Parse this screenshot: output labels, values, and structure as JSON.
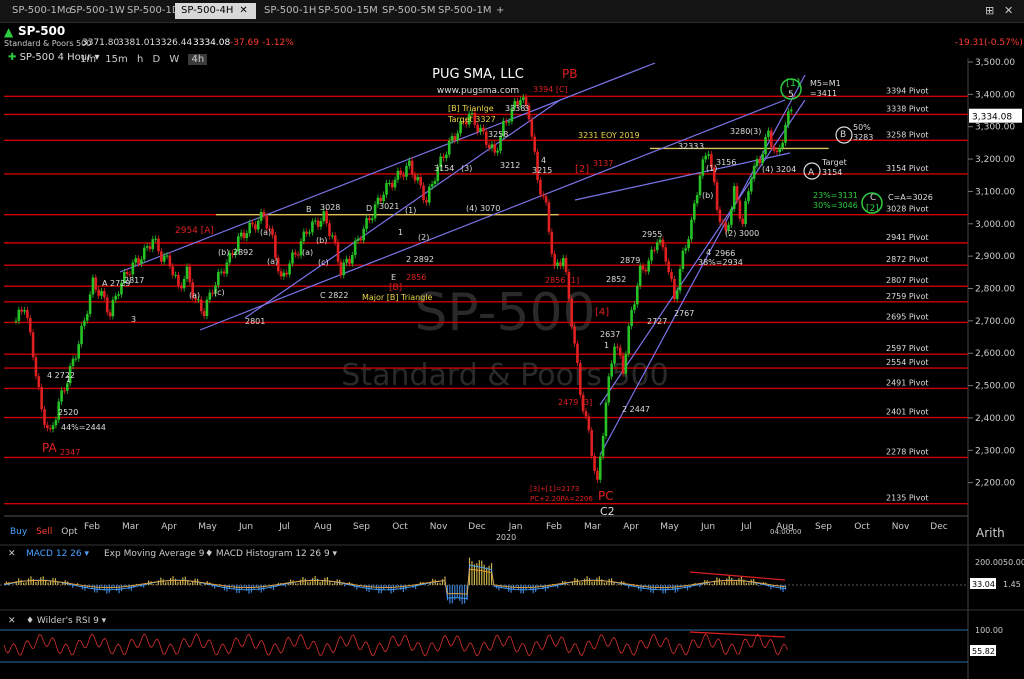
{
  "tabs": [
    {
      "label": "SP-500-1Mo",
      "active": false
    },
    {
      "label": "SP-500-1W",
      "active": false
    },
    {
      "label": "SP-500-1D",
      "active": false
    },
    {
      "label": "SP-500-4H",
      "active": true
    },
    {
      "label": "SP-500-1H",
      "active": false
    },
    {
      "label": "SP-500-15M",
      "active": false
    },
    {
      "label": "SP-500-5M",
      "active": false
    },
    {
      "label": "SP-500-1M",
      "active": false
    }
  ],
  "tab_plus": "+",
  "header": {
    "symbol": "SP-500",
    "description": "Standard & Poors 500",
    "open": "3371.80",
    "high": "3381.01",
    "low": "3326.44",
    "close": "3334.08",
    "change": "-37.69",
    "change_pct": "-1.12%",
    "right_change": "-19.31(-0.57%)"
  },
  "toolbar": {
    "panel_label": "SP-500 4 Hour",
    "timeframes": [
      "1m",
      "15m",
      "h",
      "D",
      "W",
      "4h"
    ]
  },
  "panels": {
    "macd_label": "MACD 12 26",
    "ema_label": "Exp Moving Average 9",
    "hist_label": "MACD Histogram 12 26 9",
    "rsi_label": "Wilder's RSI 9",
    "macd_axis": [
      "200.00",
      "50.00",
      "33.04",
      "1.45"
    ],
    "rsi_axis": [
      "100.00",
      "55.82"
    ]
  },
  "bottom_left": {
    "buy": "Buy",
    "sell": "Sell",
    "opt": "Opt"
  },
  "arith": "Arith",
  "time_box": "04:00:00",
  "colors": {
    "pivot": "#cc0000",
    "channel": "#7a74e8",
    "yellow": "#d8c25a",
    "up": "#26c226",
    "down": "#e02020",
    "bg": "#000000"
  },
  "chart_data": {
    "type": "candlestick",
    "title": "PUG SMA, LLC",
    "subtitle": "www.pugsma.com",
    "watermark": [
      "SP-500",
      "Standard & Poors 500"
    ],
    "ylim": [
      2100,
      3500
    ],
    "y_ticks": [
      2200,
      2300,
      2400,
      2500,
      2600,
      2700,
      2800,
      2900,
      3000,
      3100,
      3200,
      3300,
      3400,
      3500
    ],
    "y_tick_labels": [
      "2,200.00",
      "2,300.00",
      "2,400.00",
      "2,500.00",
      "2,600.00",
      "2,700.00",
      "2,800.00",
      "2,900.00",
      "3,000.00",
      "3,100.00",
      "3,200.00",
      "3,300.00",
      "3,400.00",
      "3,500.00"
    ],
    "last_price_label": "3,334.08",
    "x_labels": [
      "Feb",
      "Mar",
      "Apr",
      "May",
      "Jun",
      "Jul",
      "Aug",
      "Sep",
      "Oct",
      "Nov",
      "Dec",
      "Jan",
      "Feb",
      "Mar",
      "Apr",
      "May",
      "Jun",
      "Jul",
      "Aug",
      "Sep",
      "Oct",
      "Nov",
      "Dec"
    ],
    "x_year_label": "2020",
    "pivots": [
      {
        "label": "3394 Pivot",
        "value": 3394
      },
      {
        "label": "3338 Pivot",
        "value": 3338
      },
      {
        "label": "3258 Pivot",
        "value": 3258
      },
      {
        "label": "3154 Pivot",
        "value": 3154
      },
      {
        "label": "3028 Pivot",
        "value": 3028
      },
      {
        "label": "2941 Pivot",
        "value": 2941
      },
      {
        "label": "2872 Pivot",
        "value": 2872
      },
      {
        "label": "2807 Pivot",
        "value": 2807
      },
      {
        "label": "2759 Pivot",
        "value": 2759
      },
      {
        "label": "2695 Pivot",
        "value": 2695
      },
      {
        "label": "2597 Pivot",
        "value": 2597
      },
      {
        "label": "2554 Pivot",
        "value": 2554
      },
      {
        "label": "2491 Pivot",
        "value": 2491
      },
      {
        "label": "2401 Pivot",
        "value": 2401
      },
      {
        "label": "2278 Pivot",
        "value": 2278
      },
      {
        "label": "2135 Pivot",
        "value": 2135
      }
    ],
    "yellow_lines": [
      {
        "x": [
          0.22,
          0.7
        ],
        "value": 3028
      },
      {
        "x": [
          0.67,
          0.98
        ],
        "value": 3233
      }
    ],
    "price_path": [
      [
        0,
        2700
      ],
      [
        1,
        2750
      ],
      [
        2,
        2600
      ],
      [
        3,
        2420
      ],
      [
        4,
        2347
      ],
      [
        5,
        2444
      ],
      [
        6,
        2520
      ],
      [
        7,
        2600
      ],
      [
        8,
        2700
      ],
      [
        9,
        2817
      ],
      [
        10,
        2780
      ],
      [
        11,
        2722
      ],
      [
        12,
        2800
      ],
      [
        13,
        2850
      ],
      [
        14,
        2880
      ],
      [
        15,
        2910
      ],
      [
        16,
        2954
      ],
      [
        17,
        2900
      ],
      [
        18,
        2880
      ],
      [
        19,
        2801
      ],
      [
        20,
        2850
      ],
      [
        21,
        2760
      ],
      [
        22,
        2729
      ],
      [
        23,
        2800
      ],
      [
        24,
        2850
      ],
      [
        25,
        2892
      ],
      [
        26,
        2950
      ],
      [
        27,
        2980
      ],
      [
        28,
        3000
      ],
      [
        29,
        3028
      ],
      [
        30,
        2950
      ],
      [
        31,
        2822
      ],
      [
        32,
        2880
      ],
      [
        33,
        2920
      ],
      [
        34,
        2980
      ],
      [
        35,
        3000
      ],
      [
        36,
        3021
      ],
      [
        37,
        2960
      ],
      [
        38,
        2856
      ],
      [
        39,
        2892
      ],
      [
        40,
        2950
      ],
      [
        41,
        3000
      ],
      [
        42,
        3050
      ],
      [
        43,
        3100
      ],
      [
        44,
        3130
      ],
      [
        45,
        3154
      ],
      [
        46,
        3180
      ],
      [
        47,
        3130
      ],
      [
        48,
        3070
      ],
      [
        49,
        3150
      ],
      [
        50,
        3212
      ],
      [
        51,
        3260
      ],
      [
        52,
        3300
      ],
      [
        53,
        3338
      ],
      [
        54,
        3300
      ],
      [
        55,
        3258
      ],
      [
        56,
        3215
      ],
      [
        57,
        3300
      ],
      [
        58,
        3350
      ],
      [
        59,
        3394
      ],
      [
        60,
        3340
      ],
      [
        61,
        3137
      ],
      [
        62,
        3050
      ],
      [
        63,
        2856
      ],
      [
        64,
        2900
      ],
      [
        65,
        2700
      ],
      [
        66,
        2479
      ],
      [
        67,
        2350
      ],
      [
        68,
        2192
      ],
      [
        69,
        2447
      ],
      [
        70,
        2637
      ],
      [
        71,
        2550
      ],
      [
        72,
        2727
      ],
      [
        73,
        2852
      ],
      [
        74,
        2879
      ],
      [
        75,
        2955
      ],
      [
        76,
        2900
      ],
      [
        77,
        2767
      ],
      [
        78,
        2900
      ],
      [
        79,
        3000
      ],
      [
        80,
        3156
      ],
      [
        81,
        3233
      ],
      [
        82,
        3050
      ],
      [
        83,
        2966
      ],
      [
        84,
        3100
      ],
      [
        85,
        3000
      ],
      [
        86,
        3156
      ],
      [
        87,
        3200
      ],
      [
        88,
        3280
      ],
      [
        89,
        3204
      ],
      [
        90,
        3300
      ],
      [
        91,
        3394
      ]
    ],
    "annotations": [
      {
        "text": "3394 [C]",
        "value": 3394
      },
      {
        "text": "PB",
        "value": 3440
      },
      {
        "text": "[B] Trianlge",
        "value": 3365
      },
      {
        "text": "Target 3327",
        "value": 3327
      },
      {
        "text": "3231 EOY 2019",
        "value": 3231
      },
      {
        "text": "Major [B] Triangle",
        "value": 2770
      },
      {
        "text": "PA",
        "value": 2350
      },
      {
        "text": "2347",
        "value": 2347
      },
      {
        "text": "44%=2444",
        "value": 2440
      },
      {
        "text": "PC",
        "value": 2195
      },
      {
        "text": "C2",
        "value": 2160
      },
      {
        "text": "[3]+[1]=2173",
        "value": 2173
      },
      {
        "text": "PC+2.20PA=2206",
        "value": 2206
      },
      {
        "text": "[1]",
        "value": 3445
      },
      {
        "text": "5",
        "value": 3412
      },
      {
        "text": "M5=M1",
        "value": 3445
      },
      {
        "text": "=3411",
        "value": 3411
      },
      {
        "text": "50%",
        "value": 3300
      },
      {
        "text": "3283",
        "value": 3283
      },
      {
        "text": "B",
        "value": 3290
      },
      {
        "text": "A",
        "value": 3165
      },
      {
        "text": "Target",
        "value": 3175
      },
      {
        "text": "3154",
        "value": 3150
      },
      {
        "text": "23%=3131",
        "value": 3131
      },
      {
        "text": "30%=3046",
        "value": 3046
      },
      {
        "text": "C",
        "value": 3120
      },
      {
        "text": "[2]",
        "value": 3040
      },
      {
        "text": "C=A=3026",
        "value": 3026
      },
      {
        "text": "38%=2934",
        "value": 2934
      },
      {
        "text": "2966",
        "value": 2966
      },
      {
        "text": "(2) 3000",
        "value": 3000
      },
      {
        "text": "(4) 3204",
        "value": 3204
      },
      {
        "text": "3280",
        "value": 3290
      },
      {
        "text": "(3)",
        "value": 3290
      },
      {
        "text": "3156",
        "value": 3190
      },
      {
        "text": "3233",
        "value": 3250
      },
      {
        "text": "3",
        "value": 3250
      },
      {
        "text": "(1)",
        "value": 3180
      },
      {
        "text": "(b)",
        "value": 3090
      },
      {
        "text": "4",
        "value": 2950
      },
      {
        "text": "2955",
        "value": 2980
      },
      {
        "text": "2879",
        "value": 2900
      },
      {
        "text": "2852",
        "value": 2840
      },
      {
        "text": "2727",
        "value": 2720
      },
      {
        "text": "2767",
        "value": 2740
      },
      {
        "text": "2637",
        "value": 2640
      },
      {
        "text": "1",
        "value": 2600
      },
      {
        "text": "2 2447",
        "value": 2420
      },
      {
        "text": "[4]",
        "value": 2740
      },
      {
        "text": "2479 [3]",
        "value": 2480
      },
      {
        "text": "2856 [1]",
        "value": 2860
      },
      {
        "text": "[2]",
        "value": 3140
      },
      {
        "text": "3137",
        "value": 3200
      },
      {
        "text": "3215",
        "value": 3190
      },
      {
        "text": "4",
        "value": 3210
      },
      {
        "text": "3212",
        "value": 3210
      },
      {
        "text": "3258",
        "value": 3270
      },
      {
        "text": "3338",
        "value": 3375
      },
      {
        "text": "3",
        "value": 3375
      },
      {
        "text": "(3)",
        "value": 3180
      },
      {
        "text": "3154",
        "value": 3180
      },
      {
        "text": "(4)",
        "value": 3070
      },
      {
        "text": "3070",
        "value": 3070
      },
      {
        "text": "(1)",
        "value": 3050
      },
      {
        "text": "3021",
        "value": 3060
      },
      {
        "text": "D",
        "value": 3055
      },
      {
        "text": "1",
        "value": 3000
      },
      {
        "text": "(2)",
        "value": 2975
      },
      {
        "text": "2 2892",
        "value": 2890
      },
      {
        "text": "E",
        "value": 2840
      },
      {
        "text": "[B]",
        "value": 2820
      },
      {
        "text": "2856",
        "value": 2845
      },
      {
        "text": "3028",
        "value": 3060
      },
      {
        "text": "B",
        "value": 3050
      },
      {
        "text": "(a)",
        "value": 3000
      },
      {
        "text": "(b)",
        "value": 2970
      },
      {
        "text": "(a)",
        "value": 2940
      },
      {
        "text": "(c)",
        "value": 2900
      },
      {
        "text": "C 2822",
        "value": 2810
      },
      {
        "text": "2954 [A]",
        "value": 3000
      },
      {
        "text": "(b)",
        "value": 2920
      },
      {
        "text": "2892",
        "value": 2920
      },
      {
        "text": "(a)",
        "value": 2880
      },
      {
        "text": "(c)",
        "value": 2880
      },
      {
        "text": "(a)",
        "value": 2810
      },
      {
        "text": "2801",
        "value": 2800
      },
      {
        "text": "A 2729",
        "value": 2720
      },
      {
        "text": "2817",
        "value": 2830
      },
      {
        "text": "3",
        "value": 2830
      },
      {
        "text": "4 2722",
        "value": 2720
      },
      {
        "text": "1",
        "value": 2540
      },
      {
        "text": "2520",
        "value": 2520
      },
      {
        "text": "2 2444",
        "value": 2440
      }
    ]
  }
}
